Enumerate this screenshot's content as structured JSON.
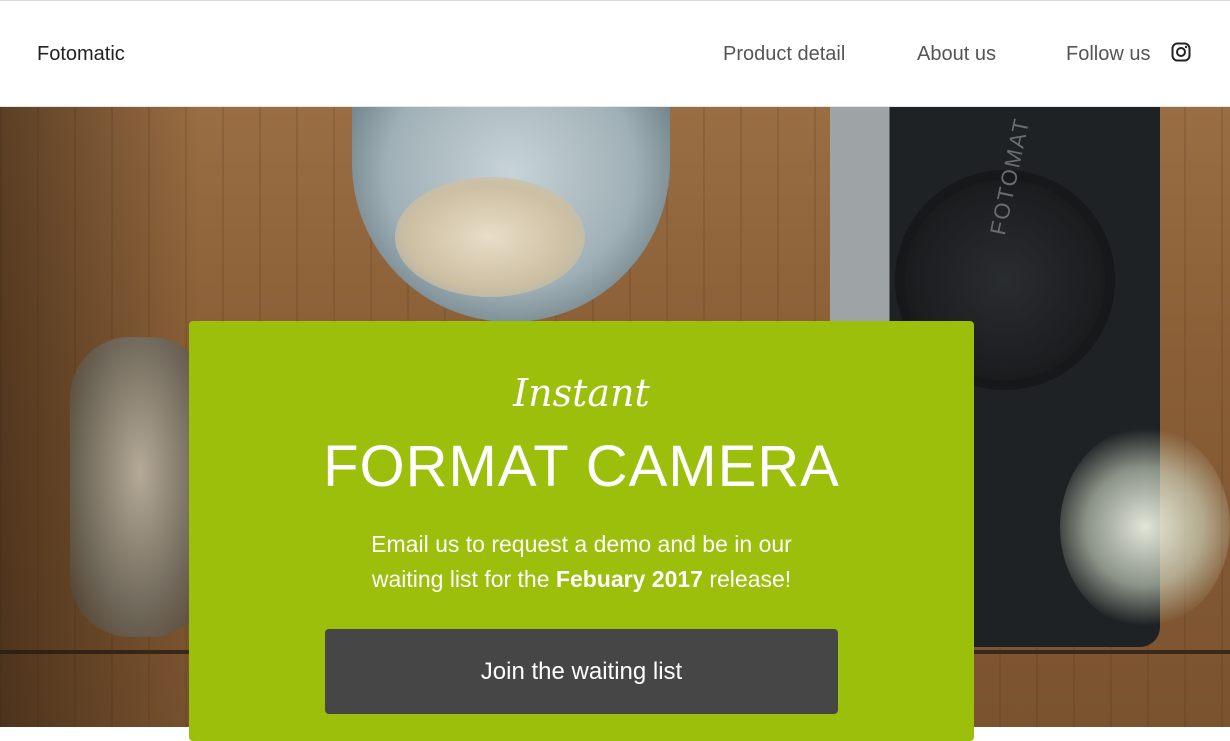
{
  "header": {
    "brand": "Fotomatic",
    "nav": {
      "product": "Product detail",
      "about": "About us",
      "follow": "Follow us"
    },
    "social_icon": "instagram-icon"
  },
  "hero": {
    "camera_brand": "FOTOMAT",
    "card": {
      "script": "Instant",
      "title": "FORMAT CAMERA",
      "desc_line1": "Email us to request a demo and be in our",
      "desc_prefix": "waiting list for the ",
      "desc_bold": "Febuary 2017",
      "desc_suffix": " release!",
      "cta": "Join the waiting list",
      "bg_color": "#9bbf0a",
      "button_color": "#464646"
    }
  }
}
